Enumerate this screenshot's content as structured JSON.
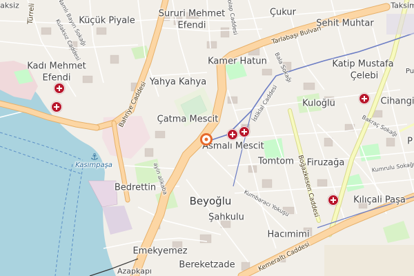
{
  "map": {
    "center_marker": "selected-location-marker",
    "colors": {
      "water": "#aad3df",
      "land": "#f2efe9",
      "primary_road": "#fcd6a4",
      "trunk_road": "#f9b29c",
      "secondary_road": "#f7fabf",
      "park": "#c8facc",
      "pitch": "#aae0cb",
      "tram": "#6b7cc4",
      "hospital": "#b8162b",
      "marker": "#e66a2c"
    },
    "labels": {
      "kadi_mehmet_1": "Kadı Mehmet",
      "kadi_mehmet_2": "Efendi",
      "kucuk_piyale": "Küçük Piyale",
      "sururi_1": "Sururi Mehmet",
      "sururi_2": "Efendi",
      "cukur": "Çukur",
      "sehit_muhtar": "Şehit Muhtar",
      "taksim": "Taksim",
      "kamer_hatun": "Kamer Hatun",
      "katip_1": "Katip Mustafa",
      "katip_2": "Çelebi",
      "yahya_kahya": "Yahya Kahya",
      "kuloglu": "Kuloğlu",
      "cihangir": "Cihangi",
      "catma_mescit": "Çatma Mescit",
      "asmali_mescit": "Asmalı Mescit",
      "tomtom": "Tomtom",
      "firuzaga": "Firuzağa",
      "bedrettin": "Bedrettin",
      "beyoglu": "Beyoğlu",
      "kilicali": "Kılıçali Paşa",
      "sahkulu": "Şahkulu",
      "hacimimi": "Hacımimi",
      "emekyemez": "Emekyemez",
      "bereketzade": "Bereketzade",
      "azapkapi": "Azapkapı",
      "kasimpasa": "Kasımpaşa",
      "bahriye": "Bahriye Caddesi",
      "tarlabasi": "Tarlabaşı Bulvarı",
      "istiklal": "İstiklal Caddesi",
      "bogazkesen": "Boğazkesen Caddesi",
      "kemeralti": "Kemeraltı Caddesi",
      "kulaksiz": "Kulaksız Caddesi",
      "namli": "Namlı Bayırı Sokağı",
      "ayin": "ayin alikaba",
      "kumbaraci": "Kumbaracı Yokuşu",
      "baktac": "Bakraç Sokağı",
      "kumrulu": "Kumrulu Sokağı",
      "turreli": "Türreli",
      "aksiz": "aksiz",
      "bala": "Bala Sokağı",
      "dolap": "Dolap Caddesi",
      "pu": "Pu",
      "p": "P"
    }
  }
}
